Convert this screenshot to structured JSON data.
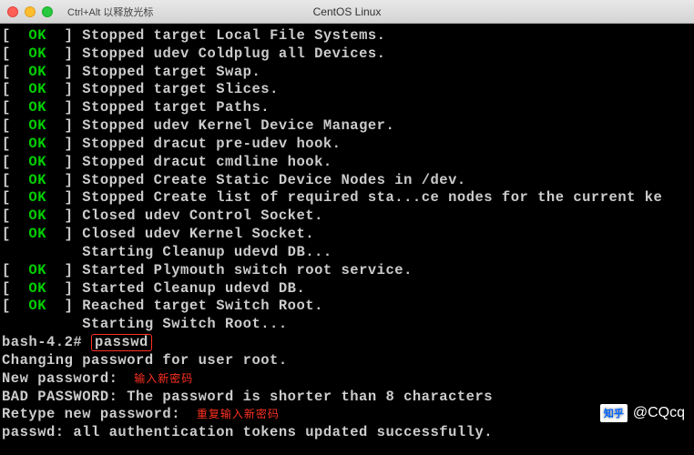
{
  "titlebar": {
    "hint": "Ctrl+Alt 以释放光标",
    "title": "CentOS Linux"
  },
  "boot_lines": [
    {
      "status": "OK",
      "msg": "Stopped target Local File Systems."
    },
    {
      "status": "OK",
      "msg": "Stopped udev Coldplug all Devices."
    },
    {
      "status": "OK",
      "msg": "Stopped target Swap."
    },
    {
      "status": "OK",
      "msg": "Stopped target Slices."
    },
    {
      "status": "OK",
      "msg": "Stopped target Paths."
    },
    {
      "status": "OK",
      "msg": "Stopped udev Kernel Device Manager."
    },
    {
      "status": "OK",
      "msg": "Stopped dracut pre-udev hook."
    },
    {
      "status": "OK",
      "msg": "Stopped dracut cmdline hook."
    },
    {
      "status": "OK",
      "msg": "Stopped Create Static Device Nodes in /dev."
    },
    {
      "status": "OK",
      "msg": "Stopped Create list of required sta...ce nodes for the current ke"
    },
    {
      "status": "OK",
      "msg": "Closed udev Control Socket."
    },
    {
      "status": "OK",
      "msg": "Closed udev Kernel Socket."
    },
    {
      "indent": true,
      "msg": "Starting Cleanup udevd DB..."
    },
    {
      "status": "OK",
      "msg": "Started Plymouth switch root service."
    },
    {
      "status": "OK",
      "msg": "Started Cleanup udevd DB."
    },
    {
      "status": "OK",
      "msg": "Reached target Switch Root."
    },
    {
      "indent": true,
      "msg": "Starting Switch Root..."
    }
  ],
  "shell": {
    "prompt": "bash-4.2# ",
    "cmd": "passwd",
    "lines": [
      {
        "text": "Changing password for user root."
      },
      {
        "text": "New password: ",
        "annotation": "输入新密码"
      },
      {
        "text": "BAD PASSWORD: The password is shorter than 8 characters"
      },
      {
        "text": "Retype new password: ",
        "annotation": "重复输入新密码"
      },
      {
        "text": "passwd: all authentication tokens updated successfully."
      }
    ]
  },
  "watermark": {
    "logo": "知乎",
    "author": "@CQcq"
  }
}
